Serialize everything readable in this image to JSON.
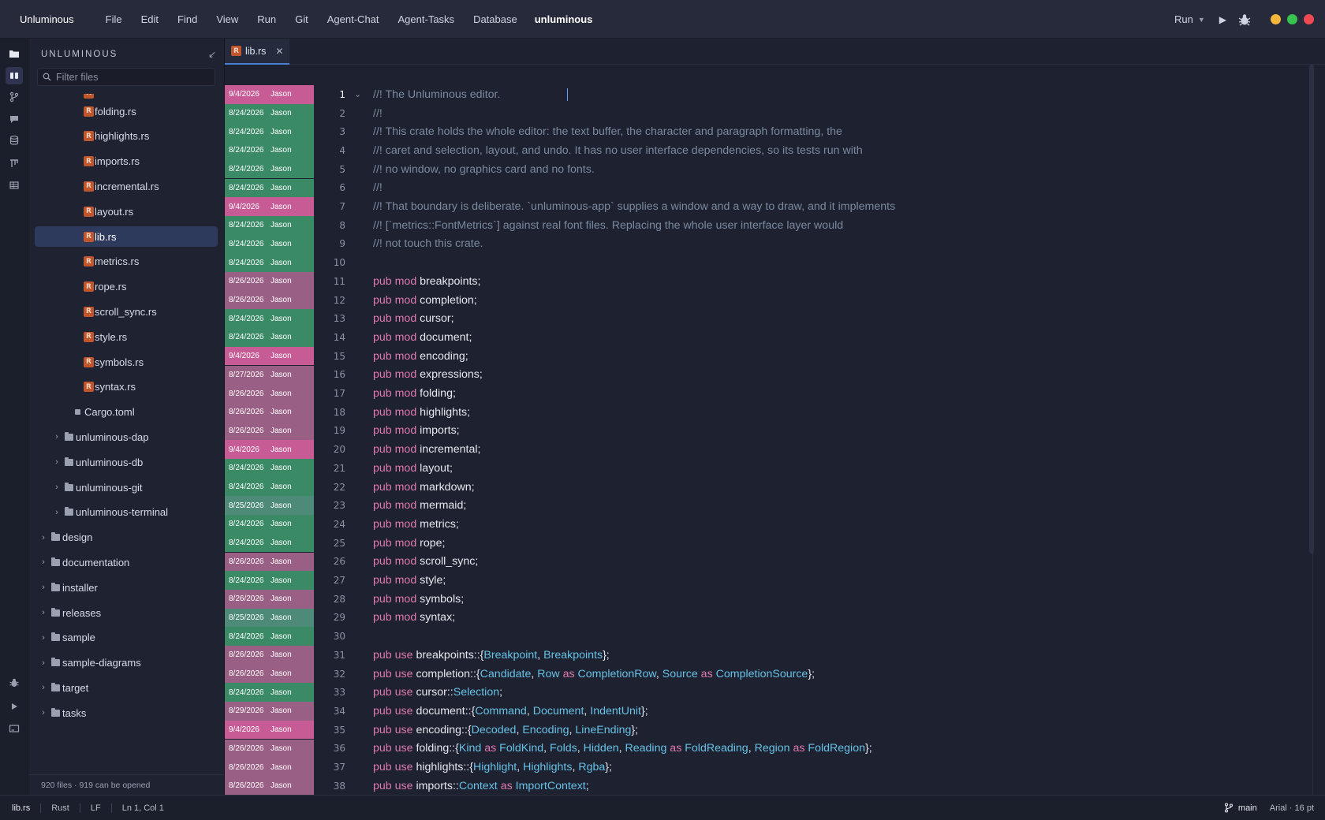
{
  "titlebar": {
    "app_name": "Unluminous",
    "menu": [
      "File",
      "Edit",
      "Find",
      "View",
      "Run",
      "Git",
      "Agent-Chat",
      "Agent-Tasks",
      "Database"
    ],
    "project": "unluminous",
    "run_label": "Run",
    "traffic_colors": [
      "#f5b73b",
      "#38c24f",
      "#ef4a52"
    ]
  },
  "activity_bar": {
    "icons": [
      "explorer-icon",
      "panels-icon",
      "git-branch-icon",
      "chat-icon",
      "database-icon",
      "tasks-icon",
      "table-icon"
    ],
    "bottom_icons": [
      "debug-icon",
      "run-icon",
      "terminal-icon"
    ]
  },
  "explorer": {
    "title": "UNLUMINOUS",
    "filter_placeholder": "Filter files",
    "items": [
      {
        "label": "folding.rs",
        "kind": "rust",
        "depth": 3
      },
      {
        "label": "highlights.rs",
        "kind": "rust",
        "depth": 3
      },
      {
        "label": "imports.rs",
        "kind": "rust",
        "depth": 3
      },
      {
        "label": "incremental.rs",
        "kind": "rust",
        "depth": 3
      },
      {
        "label": "layout.rs",
        "kind": "rust",
        "depth": 3
      },
      {
        "label": "lib.rs",
        "kind": "rust",
        "depth": 3,
        "selected": true
      },
      {
        "label": "metrics.rs",
        "kind": "rust",
        "depth": 3
      },
      {
        "label": "rope.rs",
        "kind": "rust",
        "depth": 3
      },
      {
        "label": "scroll_sync.rs",
        "kind": "rust",
        "depth": 3
      },
      {
        "label": "style.rs",
        "kind": "rust",
        "depth": 3
      },
      {
        "label": "symbols.rs",
        "kind": "rust",
        "depth": 3
      },
      {
        "label": "syntax.rs",
        "kind": "rust",
        "depth": 3
      },
      {
        "label": "Cargo.toml",
        "kind": "file",
        "depth": 2
      },
      {
        "label": "unluminous-dap",
        "kind": "folder",
        "depth": 1
      },
      {
        "label": "unluminous-db",
        "kind": "folder",
        "depth": 1
      },
      {
        "label": "unluminous-git",
        "kind": "folder",
        "depth": 1
      },
      {
        "label": "unluminous-terminal",
        "kind": "folder",
        "depth": 1
      },
      {
        "label": "design",
        "kind": "folder",
        "depth": 0
      },
      {
        "label": "documentation",
        "kind": "folder",
        "depth": 0
      },
      {
        "label": "installer",
        "kind": "folder",
        "depth": 0
      },
      {
        "label": "releases",
        "kind": "folder",
        "depth": 0
      },
      {
        "label": "sample",
        "kind": "folder",
        "depth": 0
      },
      {
        "label": "sample-diagrams",
        "kind": "folder",
        "depth": 0
      },
      {
        "label": "target",
        "kind": "folder",
        "depth": 0
      },
      {
        "label": "tasks",
        "kind": "folder",
        "depth": 0
      }
    ],
    "footer": "920 files  ·  919 can be opened"
  },
  "tab": {
    "label": "lib.rs",
    "icon_letter": "R"
  },
  "editor": {
    "lines": [
      {
        "date": "9/4/2026",
        "author": "Jason",
        "color": "pink",
        "tokens": [
          [
            "c",
            "//! The Unluminous editor."
          ]
        ]
      },
      {
        "date": "8/24/2026",
        "author": "Jason",
        "color": "green",
        "tokens": [
          [
            "c",
            "//!"
          ]
        ]
      },
      {
        "date": "8/24/2026",
        "author": "Jason",
        "color": "green",
        "tokens": [
          [
            "c",
            "//! This crate holds the whole editor: the text buffer, the character and paragraph formatting, the"
          ]
        ]
      },
      {
        "date": "8/24/2026",
        "author": "Jason",
        "color": "green",
        "tokens": [
          [
            "c",
            "//! caret and selection, layout, and undo. It has no user interface dependencies, so its tests run with"
          ]
        ]
      },
      {
        "date": "8/24/2026",
        "author": "Jason",
        "color": "green",
        "tokens": [
          [
            "c",
            "//! no window, no graphics card and no fonts."
          ]
        ]
      },
      {
        "date": "8/24/2026",
        "author": "Jason",
        "color": "green",
        "tokens": [
          [
            "c",
            "//!"
          ]
        ]
      },
      {
        "date": "9/4/2026",
        "author": "Jason",
        "color": "pink",
        "tokens": [
          [
            "c",
            "//! That boundary is deliberate. `unluminous-app` supplies a window and a way to draw, and it implements"
          ]
        ]
      },
      {
        "date": "8/24/2026",
        "author": "Jason",
        "color": "green",
        "tokens": [
          [
            "c",
            "//! [`metrics::FontMetrics`] against real font files. Replacing the whole user interface layer would"
          ]
        ]
      },
      {
        "date": "8/24/2026",
        "author": "Jason",
        "color": "green",
        "tokens": [
          [
            "c",
            "//! not touch this crate."
          ]
        ]
      },
      {
        "date": "8/24/2026",
        "author": "Jason",
        "color": "green",
        "tokens": []
      },
      {
        "date": "8/26/2026",
        "author": "Jason",
        "color": "mauve",
        "tokens": [
          [
            "k",
            "pub mod "
          ],
          [
            "p",
            "breakpoints;"
          ]
        ]
      },
      {
        "date": "8/26/2026",
        "author": "Jason",
        "color": "mauve",
        "tokens": [
          [
            "k",
            "pub mod "
          ],
          [
            "p",
            "completion;"
          ]
        ]
      },
      {
        "date": "8/24/2026",
        "author": "Jason",
        "color": "green",
        "tokens": [
          [
            "k",
            "pub mod "
          ],
          [
            "p",
            "cursor;"
          ]
        ]
      },
      {
        "date": "8/24/2026",
        "author": "Jason",
        "color": "green",
        "tokens": [
          [
            "k",
            "pub mod "
          ],
          [
            "p",
            "document;"
          ]
        ]
      },
      {
        "date": "9/4/2026",
        "author": "Jason",
        "color": "pink",
        "tokens": [
          [
            "k",
            "pub mod "
          ],
          [
            "p",
            "encoding;"
          ]
        ]
      },
      {
        "date": "8/27/2026",
        "author": "Jason",
        "color": "mauve",
        "tokens": [
          [
            "k",
            "pub mod "
          ],
          [
            "p",
            "expressions;"
          ]
        ]
      },
      {
        "date": "8/26/2026",
        "author": "Jason",
        "color": "mauve",
        "tokens": [
          [
            "k",
            "pub mod "
          ],
          [
            "p",
            "folding;"
          ]
        ]
      },
      {
        "date": "8/26/2026",
        "author": "Jason",
        "color": "mauve",
        "tokens": [
          [
            "k",
            "pub mod "
          ],
          [
            "p",
            "highlights;"
          ]
        ]
      },
      {
        "date": "8/26/2026",
        "author": "Jason",
        "color": "mauve",
        "tokens": [
          [
            "k",
            "pub mod "
          ],
          [
            "p",
            "imports;"
          ]
        ]
      },
      {
        "date": "9/4/2026",
        "author": "Jason",
        "color": "pink",
        "tokens": [
          [
            "k",
            "pub mod "
          ],
          [
            "p",
            "incremental;"
          ]
        ]
      },
      {
        "date": "8/24/2026",
        "author": "Jason",
        "color": "green",
        "tokens": [
          [
            "k",
            "pub mod "
          ],
          [
            "p",
            "layout;"
          ]
        ]
      },
      {
        "date": "8/24/2026",
        "author": "Jason",
        "color": "green",
        "tokens": [
          [
            "k",
            "pub mod "
          ],
          [
            "p",
            "markdown;"
          ]
        ]
      },
      {
        "date": "8/25/2026",
        "author": "Jason",
        "color": "teal",
        "tokens": [
          [
            "k",
            "pub mod "
          ],
          [
            "p",
            "mermaid;"
          ]
        ]
      },
      {
        "date": "8/24/2026",
        "author": "Jason",
        "color": "green",
        "tokens": [
          [
            "k",
            "pub mod "
          ],
          [
            "p",
            "metrics;"
          ]
        ]
      },
      {
        "date": "8/24/2026",
        "author": "Jason",
        "color": "green",
        "tokens": [
          [
            "k",
            "pub mod "
          ],
          [
            "p",
            "rope;"
          ]
        ]
      },
      {
        "date": "8/26/2026",
        "author": "Jason",
        "color": "mauve",
        "tokens": [
          [
            "k",
            "pub mod "
          ],
          [
            "p",
            "scroll_sync;"
          ]
        ]
      },
      {
        "date": "8/24/2026",
        "author": "Jason",
        "color": "green",
        "tokens": [
          [
            "k",
            "pub mod "
          ],
          [
            "p",
            "style;"
          ]
        ]
      },
      {
        "date": "8/26/2026",
        "author": "Jason",
        "color": "mauve",
        "tokens": [
          [
            "k",
            "pub mod "
          ],
          [
            "p",
            "symbols;"
          ]
        ]
      },
      {
        "date": "8/25/2026",
        "author": "Jason",
        "color": "teal",
        "tokens": [
          [
            "k",
            "pub mod "
          ],
          [
            "p",
            "syntax;"
          ]
        ]
      },
      {
        "date": "8/24/2026",
        "author": "Jason",
        "color": "green",
        "tokens": []
      },
      {
        "date": "8/26/2026",
        "author": "Jason",
        "color": "mauve",
        "tokens": [
          [
            "k",
            "pub use "
          ],
          [
            "p",
            "breakpoints::{"
          ],
          [
            "t",
            "Breakpoint"
          ],
          [
            "p",
            ", "
          ],
          [
            "t",
            "Breakpoints"
          ],
          [
            "p",
            "};"
          ]
        ]
      },
      {
        "date": "8/26/2026",
        "author": "Jason",
        "color": "mauve",
        "tokens": [
          [
            "k",
            "pub use "
          ],
          [
            "p",
            "completion::{"
          ],
          [
            "t",
            "Candidate"
          ],
          [
            "p",
            ", "
          ],
          [
            "t",
            "Row"
          ],
          [
            "k",
            " as "
          ],
          [
            "t",
            "CompletionRow"
          ],
          [
            "p",
            ", "
          ],
          [
            "t",
            "Source"
          ],
          [
            "k",
            " as "
          ],
          [
            "t",
            "CompletionSource"
          ],
          [
            "p",
            "};"
          ]
        ]
      },
      {
        "date": "8/24/2026",
        "author": "Jason",
        "color": "green",
        "tokens": [
          [
            "k",
            "pub use "
          ],
          [
            "p",
            "cursor::"
          ],
          [
            "t",
            "Selection"
          ],
          [
            "p",
            ";"
          ]
        ]
      },
      {
        "date": "8/29/2026",
        "author": "Jason",
        "color": "mauve",
        "tokens": [
          [
            "k",
            "pub use "
          ],
          [
            "p",
            "document::{"
          ],
          [
            "t",
            "Command"
          ],
          [
            "p",
            ", "
          ],
          [
            "t",
            "Document"
          ],
          [
            "p",
            ", "
          ],
          [
            "t",
            "IndentUnit"
          ],
          [
            "p",
            "};"
          ]
        ]
      },
      {
        "date": "9/4/2026",
        "author": "Jason",
        "color": "pink",
        "tokens": [
          [
            "k",
            "pub use "
          ],
          [
            "p",
            "encoding::{"
          ],
          [
            "t",
            "Decoded"
          ],
          [
            "p",
            ", "
          ],
          [
            "t",
            "Encoding"
          ],
          [
            "p",
            ", "
          ],
          [
            "t",
            "LineEnding"
          ],
          [
            "p",
            "};"
          ]
        ]
      },
      {
        "date": "8/26/2026",
        "author": "Jason",
        "color": "mauve",
        "tokens": [
          [
            "k",
            "pub use "
          ],
          [
            "p",
            "folding::{"
          ],
          [
            "t",
            "Kind"
          ],
          [
            "k",
            " as "
          ],
          [
            "t",
            "FoldKind"
          ],
          [
            "p",
            ", "
          ],
          [
            "t",
            "Folds"
          ],
          [
            "p",
            ", "
          ],
          [
            "t",
            "Hidden"
          ],
          [
            "p",
            ", "
          ],
          [
            "t",
            "Reading"
          ],
          [
            "k",
            " as "
          ],
          [
            "t",
            "FoldReading"
          ],
          [
            "p",
            ", "
          ],
          [
            "t",
            "Region"
          ],
          [
            "k",
            " as "
          ],
          [
            "t",
            "FoldRegion"
          ],
          [
            "p",
            "};"
          ]
        ]
      },
      {
        "date": "8/26/2026",
        "author": "Jason",
        "color": "mauve",
        "tokens": [
          [
            "k",
            "pub use "
          ],
          [
            "p",
            "highlights::{"
          ],
          [
            "t",
            "Highlight"
          ],
          [
            "p",
            ", "
          ],
          [
            "t",
            "Highlights"
          ],
          [
            "p",
            ", "
          ],
          [
            "t",
            "Rgba"
          ],
          [
            "p",
            "};"
          ]
        ]
      },
      {
        "date": "8/26/2026",
        "author": "Jason",
        "color": "mauve",
        "tokens": [
          [
            "k",
            "pub use "
          ],
          [
            "p",
            "imports::"
          ],
          [
            "t",
            "Context"
          ],
          [
            "k",
            " as "
          ],
          [
            "t",
            "ImportContext"
          ],
          [
            "p",
            ";"
          ]
        ]
      }
    ]
  },
  "status": {
    "file": "lib.rs",
    "language": "Rust",
    "line_ending": "LF",
    "position": "Ln 1, Col 1",
    "branch": "main",
    "font": "Arial · 16 pt"
  }
}
